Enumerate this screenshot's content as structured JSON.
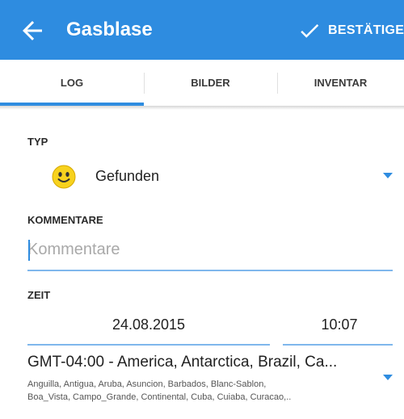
{
  "appbar": {
    "title": "Gasblase",
    "confirm_label": "BESTÄTIGEN",
    "back_icon": "arrow-left-icon",
    "confirm_icon": "checkmark-icon",
    "color": "#2e8ce0"
  },
  "tabs": [
    {
      "label": "LOG",
      "selected": true
    },
    {
      "label": "BILDER",
      "selected": false
    },
    {
      "label": "INVENTAR",
      "selected": false
    }
  ],
  "form": {
    "type_label": "TYP",
    "type_value": "Gefunden",
    "type_icon": "smiley-icon",
    "comment_label": "KOMMENTARE",
    "comment_placeholder": "Kommentare",
    "comment_value": "",
    "time_label": "ZEIT",
    "date_value": "24.08.2015",
    "time_value": "10:07",
    "timezone_title": "GMT-04:00 - America, Antarctica, Brazil, Ca...",
    "timezone_line1": "Anguilla, Antigua, Aruba, Asuncion, Barbados, Blanc-Sablon,",
    "timezone_line2": "Boa_Vista, Campo_Grande, Continental, Cuba, Cuiaba, Curacao,.."
  }
}
